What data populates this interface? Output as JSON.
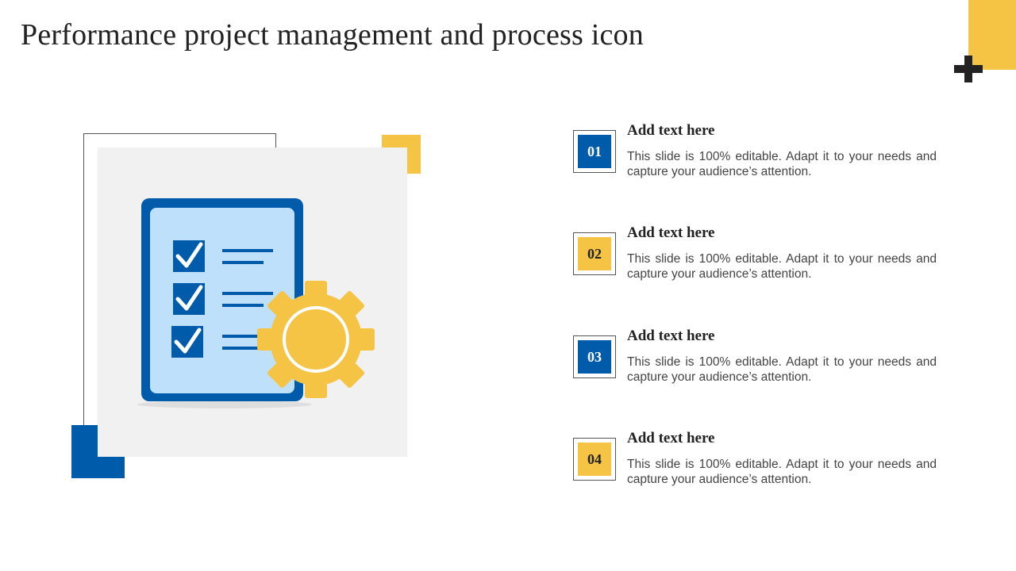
{
  "slide": {
    "title": "Performance project management and process icon"
  },
  "colors": {
    "blue": "#005bab",
    "yellow": "#f5c445",
    "light_blue": "#bfe0fa",
    "panel_gray": "#f1f1f1",
    "text_dark": "#222222"
  },
  "illustration": {
    "icons": [
      "checklist-icon",
      "gear-icon",
      "checkmark-icon"
    ]
  },
  "steps": [
    {
      "number": "01",
      "title": "Add text here",
      "text": "This slide is 100% editable. Adapt it to your needs and capture your audience’s attention."
    },
    {
      "number": "02",
      "title": "Add text here",
      "text": "This slide is 100% editable. Adapt it to your needs and capture your audience’s attention."
    },
    {
      "number": "03",
      "title": "Add text here",
      "text": "This slide is 100% editable. Adapt it to your needs and capture your audience’s attention."
    },
    {
      "number": "04",
      "title": "Add text here",
      "text": "This slide is 100% editable. Adapt it to your needs and capture your audience’s attention."
    }
  ]
}
